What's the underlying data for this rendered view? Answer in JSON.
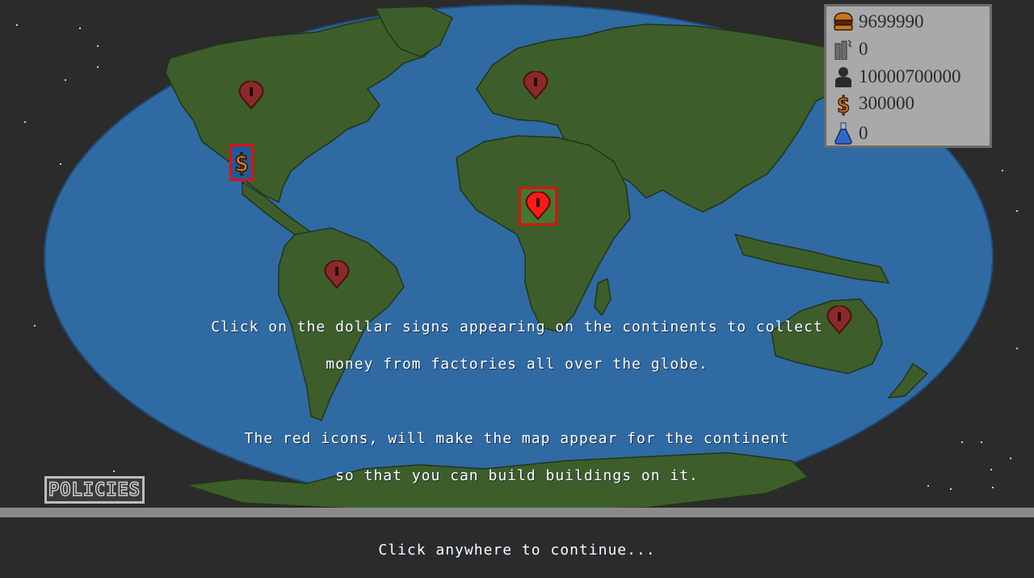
{
  "resources": {
    "food": {
      "icon": "burger-icon",
      "value": "9699990"
    },
    "pollution": {
      "icon": "factory-chimney-icon",
      "value": "0"
    },
    "population": {
      "icon": "person-icon",
      "value": "10000700000"
    },
    "money": {
      "icon": "dollar-icon",
      "value": "300000"
    },
    "research": {
      "icon": "flask-icon",
      "value": "0"
    }
  },
  "tutorial": {
    "line1": "Click on the dollar signs appearing on the continents to collect",
    "line2": "money from factories all over the globe.",
    "line3": "The red icons, will make the map appear for the continent",
    "line4": "so that you can build buildings on it.",
    "line5": "Click anywhere to continue..."
  },
  "policies_button": {
    "label": "POLICIES"
  },
  "map_markers": [
    {
      "name": "north-america",
      "icon": "map-pin-icon"
    },
    {
      "name": "europe",
      "icon": "map-pin-icon"
    },
    {
      "name": "africa",
      "icon": "map-pin-icon",
      "selected": true
    },
    {
      "name": "south-america",
      "icon": "map-pin-icon"
    },
    {
      "name": "australia",
      "icon": "map-pin-icon"
    },
    {
      "name": "north-america-collect",
      "icon": "dollar-icon"
    }
  ],
  "colors": {
    "background": "#2b2b2b",
    "ocean": "#2f6aa3",
    "land": "#3d5e2a",
    "pin": "#8b2a2a",
    "pin_active": "#e01010",
    "panel": "#a9a9a9"
  }
}
